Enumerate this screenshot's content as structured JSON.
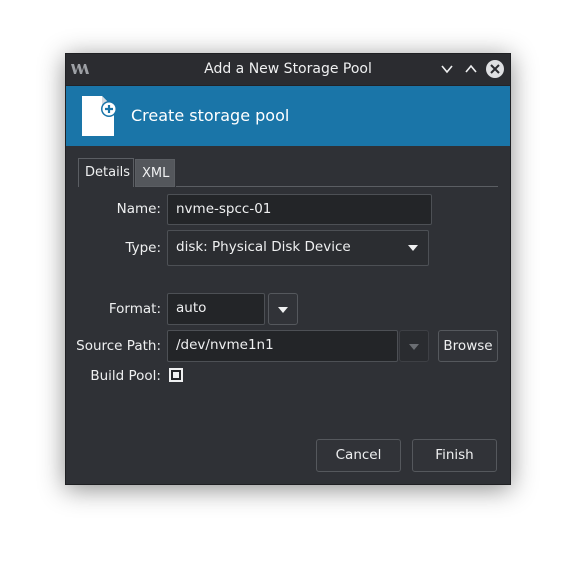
{
  "window": {
    "title": "Add a New Storage Pool",
    "buttons": {
      "minimize": "chevron-down-icon",
      "maximize": "chevron-up-icon",
      "close": "close-icon"
    }
  },
  "banner": {
    "title": "Create storage pool",
    "icon": "document-add-icon",
    "color": "#1a75a8"
  },
  "tabs": [
    {
      "label": "Details",
      "active": true
    },
    {
      "label": "XML",
      "active": false
    }
  ],
  "form": {
    "name": {
      "label": "Name:",
      "value": "nvme-spcc-01"
    },
    "type": {
      "label": "Type:",
      "value": "disk: Physical Disk Device"
    },
    "format": {
      "label": "Format:",
      "value": "auto"
    },
    "source_path": {
      "label": "Source Path:",
      "value": "/dev/nvme1n1",
      "browse_label": "Browse"
    },
    "build_pool": {
      "label": "Build Pool:",
      "checked": true
    }
  },
  "footer": {
    "cancel_label": "Cancel",
    "finish_label": "Finish"
  }
}
